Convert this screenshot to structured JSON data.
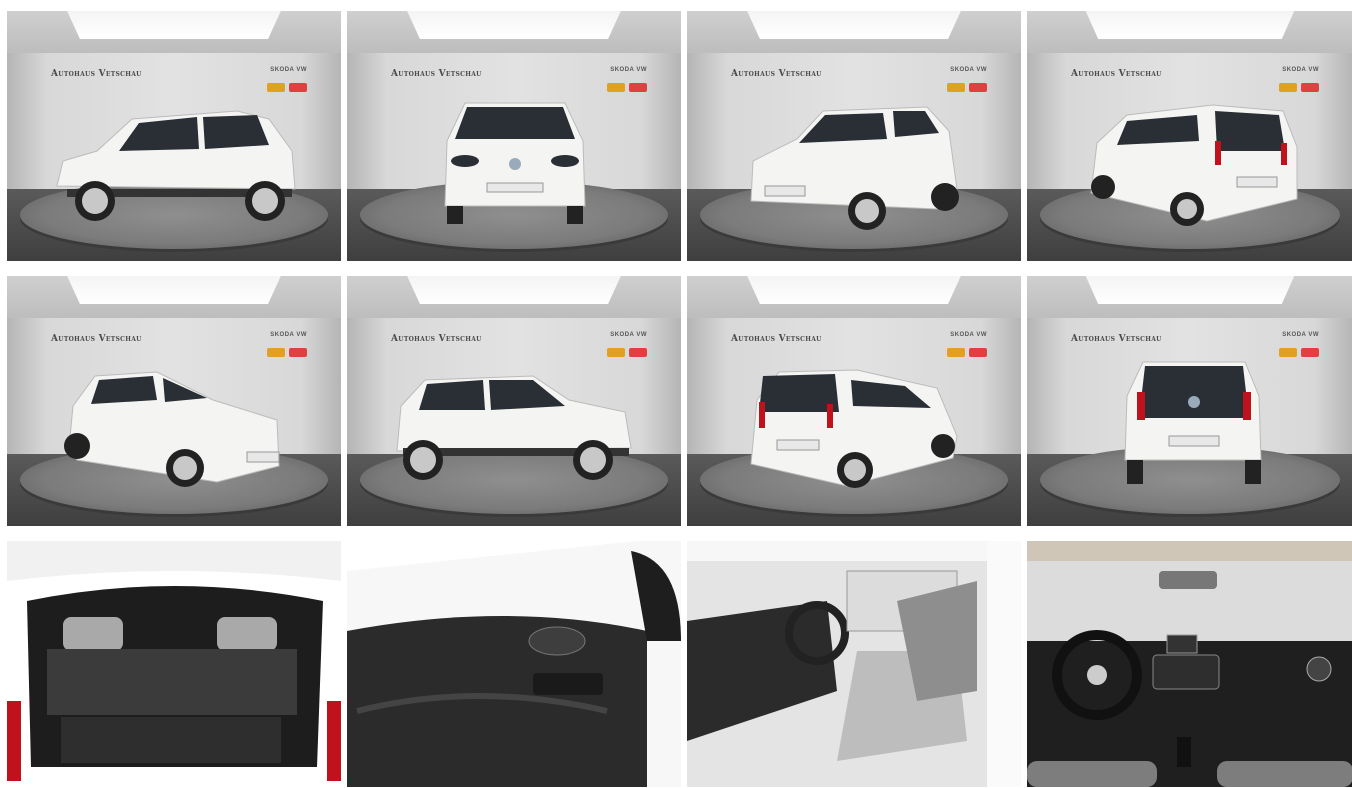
{
  "gallery": {
    "brand": "Autohaus Vetschau",
    "partner_logos": "SKODA  VW",
    "tiles": [
      {
        "view": "side-left"
      },
      {
        "view": "front"
      },
      {
        "view": "front-three-quarter-right"
      },
      {
        "view": "rear-three-quarter-left"
      },
      {
        "view": "front-three-quarter-left"
      },
      {
        "view": "side-right"
      },
      {
        "view": "rear-three-quarter-right"
      },
      {
        "view": "rear"
      },
      {
        "view": "trunk"
      },
      {
        "view": "door-panel"
      },
      {
        "view": "front-seats"
      },
      {
        "view": "dashboard"
      }
    ]
  },
  "colors": {
    "car_body": "#f4f4f2",
    "tail_light": "#c0121c",
    "interior_dark": "#2b2b2b",
    "seat_gray": "#8e8e8e"
  }
}
